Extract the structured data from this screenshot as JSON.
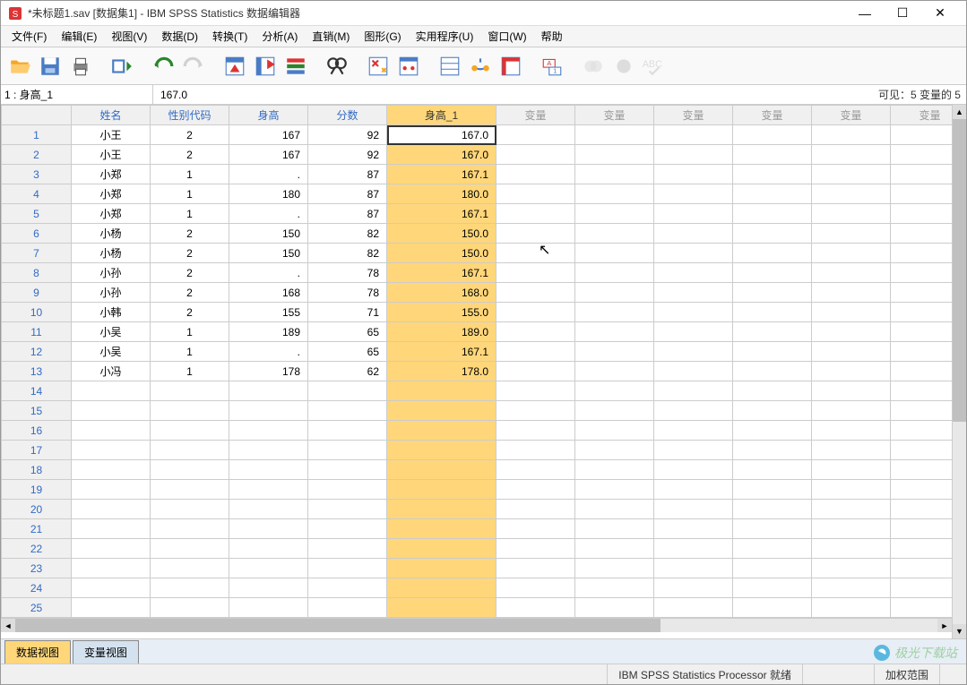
{
  "titlebar": {
    "text": "*未标题1.sav [数据集1] - IBM SPSS Statistics 数据编辑器"
  },
  "win": {
    "min": "—",
    "max": "☐",
    "close": "✕"
  },
  "menu": {
    "file": "文件(F)",
    "edit": "编辑(E)",
    "view": "视图(V)",
    "data": "数据(D)",
    "transform": "转换(T)",
    "analyze": "分析(A)",
    "direct": "直销(M)",
    "graph": "图形(G)",
    "util": "实用程序(U)",
    "window": "窗口(W)",
    "help": "帮助"
  },
  "refbar": {
    "cell": "1 : 身高_1",
    "value": "167.0",
    "right": "可见：5 变量的 5"
  },
  "columns": {
    "c1": "姓名",
    "c2": "性别代码",
    "c3": "身高",
    "c4": "分数",
    "c5": "身高_1",
    "empty": "变量"
  },
  "rows": [
    {
      "n": "1",
      "name": "小王",
      "sex": "2",
      "h": "167",
      "score": "92",
      "h1": "167.0",
      "sel": true
    },
    {
      "n": "2",
      "name": "小王",
      "sex": "2",
      "h": "167",
      "score": "92",
      "h1": "167.0"
    },
    {
      "n": "3",
      "name": "小郑",
      "sex": "1",
      "h": ".",
      "score": "87",
      "h1": "167.1"
    },
    {
      "n": "4",
      "name": "小郑",
      "sex": "1",
      "h": "180",
      "score": "87",
      "h1": "180.0"
    },
    {
      "n": "5",
      "name": "小郑",
      "sex": "1",
      "h": ".",
      "score": "87",
      "h1": "167.1"
    },
    {
      "n": "6",
      "name": "小杨",
      "sex": "2",
      "h": "150",
      "score": "82",
      "h1": "150.0"
    },
    {
      "n": "7",
      "name": "小杨",
      "sex": "2",
      "h": "150",
      "score": "82",
      "h1": "150.0"
    },
    {
      "n": "8",
      "name": "小孙",
      "sex": "2",
      "h": ".",
      "score": "78",
      "h1": "167.1"
    },
    {
      "n": "9",
      "name": "小孙",
      "sex": "2",
      "h": "168",
      "score": "78",
      "h1": "168.0"
    },
    {
      "n": "10",
      "name": "小韩",
      "sex": "2",
      "h": "155",
      "score": "71",
      "h1": "155.0"
    },
    {
      "n": "11",
      "name": "小吴",
      "sex": "1",
      "h": "189",
      "score": "65",
      "h1": "189.0"
    },
    {
      "n": "12",
      "name": "小吴",
      "sex": "1",
      "h": ".",
      "score": "65",
      "h1": "167.1"
    },
    {
      "n": "13",
      "name": "小冯",
      "sex": "1",
      "h": "178",
      "score": "62",
      "h1": "178.0"
    }
  ],
  "empty_rows": [
    "14",
    "15",
    "16",
    "17",
    "18",
    "19",
    "20",
    "21",
    "22",
    "23",
    "24",
    "25"
  ],
  "tabs": {
    "data": "数据视图",
    "var": "变量视图"
  },
  "status": {
    "processor": "IBM SPSS Statistics Processor 就绪",
    "weight": "加权范围"
  },
  "watermark": "极光下载站"
}
